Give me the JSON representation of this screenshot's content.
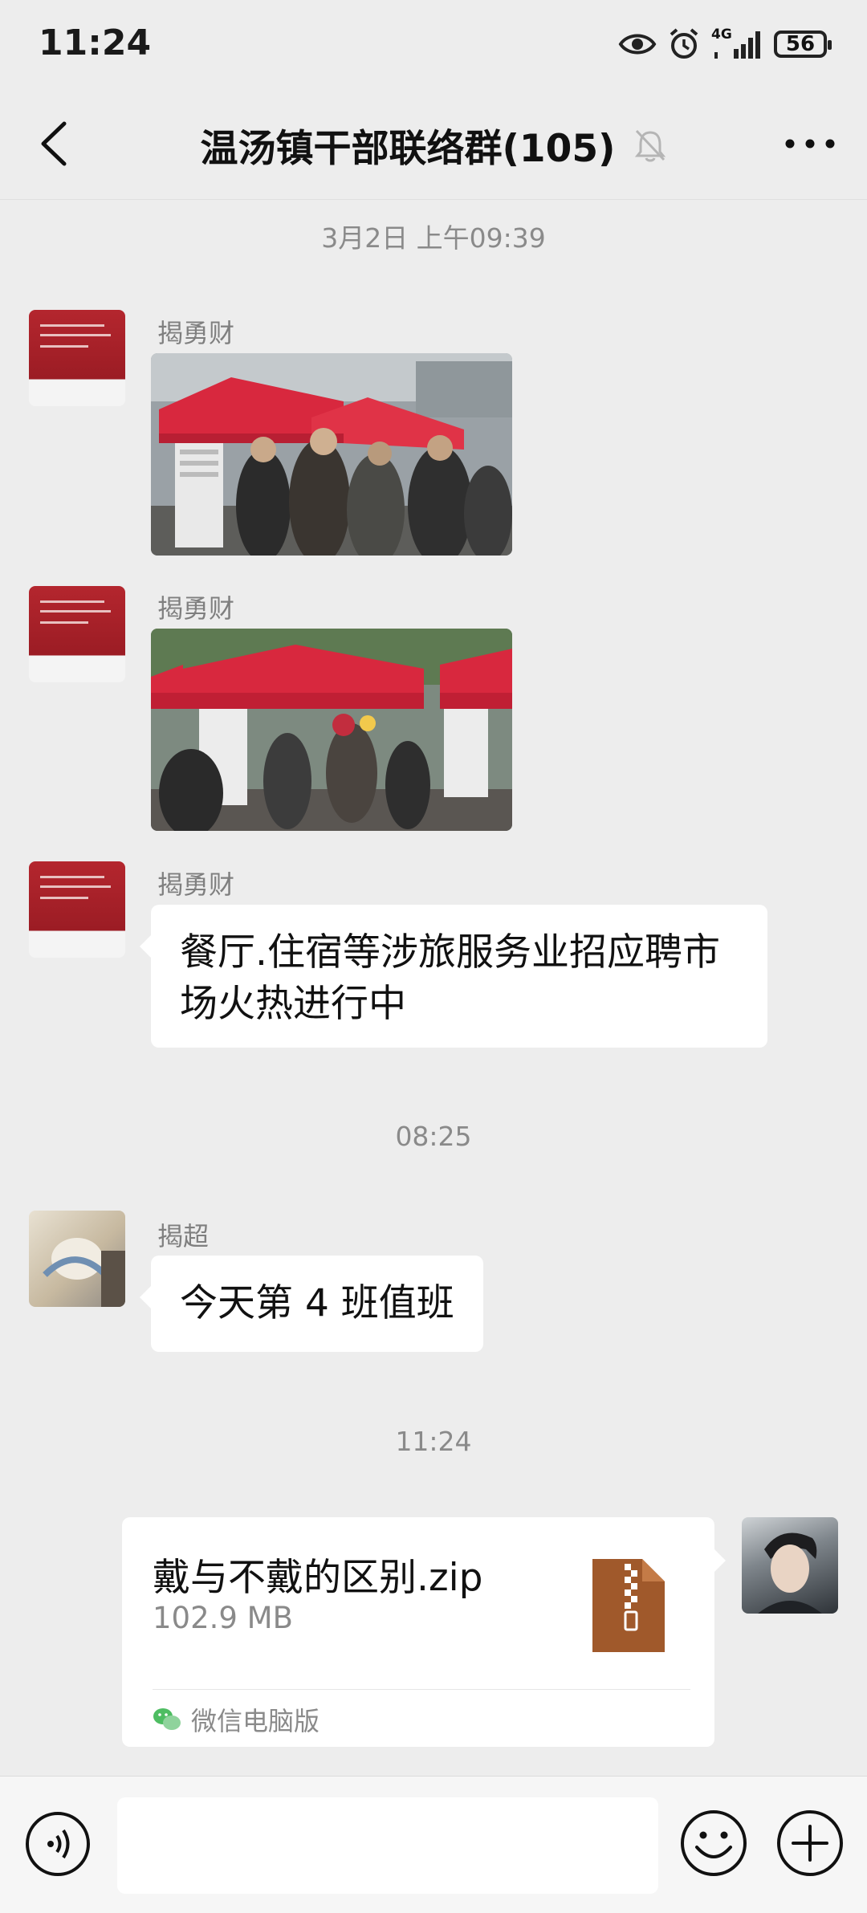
{
  "status_bar": {
    "time": "11:24",
    "network": "4G",
    "battery": "56"
  },
  "header": {
    "title": "温汤镇干部联络群(105)"
  },
  "messages": {
    "ts1": "3月2日 上午09:39",
    "m1_sender": "揭勇财",
    "m2_sender": "揭勇财",
    "m3_sender": "揭勇财",
    "m3_text": "餐厅.住宿等涉旅服务业招应聘市场火热进行中",
    "ts2": "08:25",
    "m4_sender": "揭超",
    "m4_text": "今天第 4 班值班",
    "ts3": "11:24",
    "file": {
      "name": "戴与不戴的区别.zip",
      "size": "102.9 MB",
      "source": "微信电脑版"
    }
  },
  "input_bar": {
    "placeholder": ""
  },
  "colors": {
    "background": "#ededed",
    "bubble": "#ffffff",
    "tent_red": "#d8283e",
    "zip_brown": "#a0592b",
    "wechat_green": "#4ebd62"
  }
}
